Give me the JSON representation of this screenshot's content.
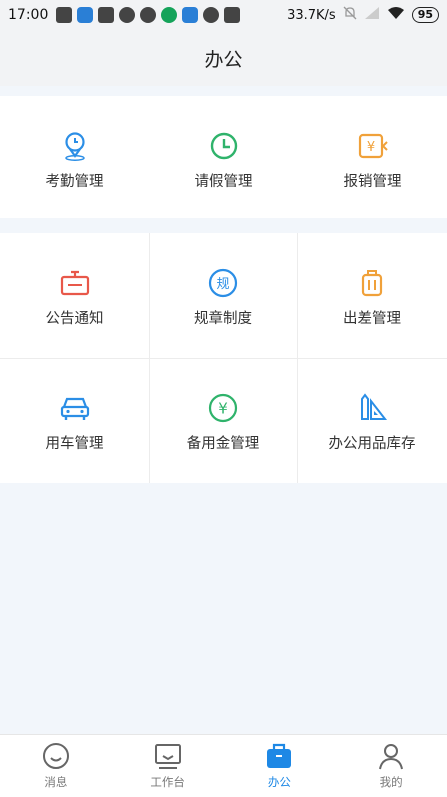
{
  "status_bar": {
    "time": "17:00",
    "network_speed": "33.7K/s",
    "battery": "95"
  },
  "header": {
    "title": "办公"
  },
  "section1": [
    {
      "label": "考勤管理",
      "icon": "location-pin-icon",
      "color": "#2b8ee6"
    },
    {
      "label": "请假管理",
      "icon": "clock-icon",
      "color": "#2fb36b"
    },
    {
      "label": "报销管理",
      "icon": "reimburse-icon",
      "color": "#f0a13a"
    }
  ],
  "section2": [
    {
      "label": "公告通知",
      "icon": "notice-board-icon",
      "color": "#e8584a"
    },
    {
      "label": "规章制度",
      "icon": "rules-icon",
      "color": "#2b8ee6"
    },
    {
      "label": "出差管理",
      "icon": "luggage-icon",
      "color": "#f0a13a"
    },
    {
      "label": "用车管理",
      "icon": "car-icon",
      "color": "#2b8ee6"
    },
    {
      "label": "备用金管理",
      "icon": "yuan-coin-icon",
      "color": "#2fb36b"
    },
    {
      "label": "办公用品库存",
      "icon": "stationery-icon",
      "color": "#2b8ee6"
    }
  ],
  "tabbar": [
    {
      "label": "消息",
      "icon": "message-face-icon",
      "active": false
    },
    {
      "label": "工作台",
      "icon": "monitor-icon",
      "active": false
    },
    {
      "label": "办公",
      "icon": "briefcase-icon",
      "active": true
    },
    {
      "label": "我的",
      "icon": "person-icon",
      "active": false
    }
  ],
  "colors": {
    "accent": "#1e88e5",
    "background": "#f2f6fb"
  }
}
